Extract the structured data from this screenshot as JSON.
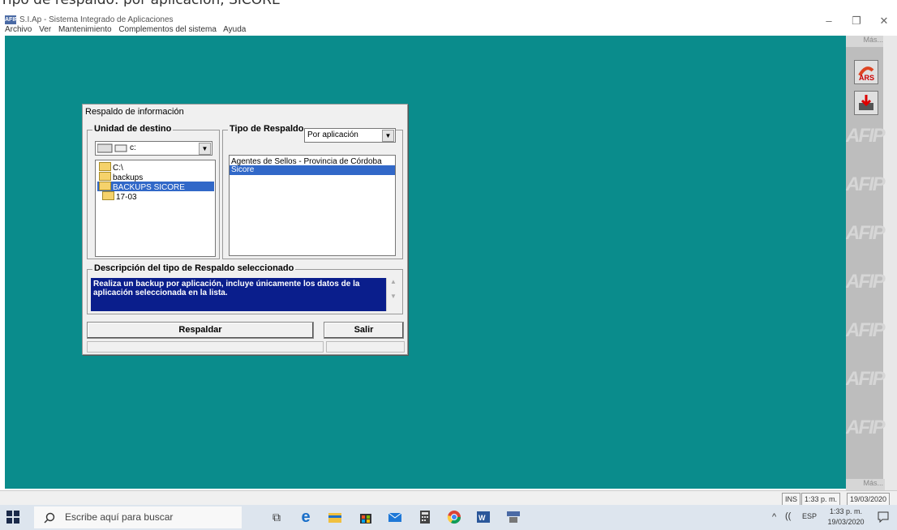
{
  "caption_crop": "Tipo de respaldo: por aplicación, SICORE",
  "window": {
    "title": "S.I.Ap - Sistema Integrado de Aplicaciones",
    "icon_text": "AFIP",
    "menu": [
      "Archivo",
      "Ver",
      "Mantenimiento",
      "Complementos del sistema",
      "Ayuda"
    ]
  },
  "right_panel": {
    "more_label_top": "Más...",
    "more_label_bottom": "Más...",
    "buttons": [
      {
        "icon": "ars-icon",
        "label": "ARS"
      },
      {
        "icon": "download-icon"
      }
    ],
    "watermark_text": "AFIP"
  },
  "dialog": {
    "title": "Respaldo de información",
    "destination": {
      "group_label": "Unidad de destino",
      "drive_value": "c:",
      "tree": [
        {
          "label": "C:\\",
          "selected": false,
          "indent": 0
        },
        {
          "label": "backups",
          "selected": false,
          "indent": 0
        },
        {
          "label": "BACKUPS SICORE",
          "selected": true,
          "indent": 0
        },
        {
          "label": "17-03",
          "selected": false,
          "indent": 1
        }
      ]
    },
    "backup_type": {
      "group_label": "Tipo de Respaldo",
      "select_value": "Por aplicación",
      "items": [
        {
          "label": "Agentes de Sellos - Provincia de Córdoba",
          "selected": false
        },
        {
          "label": "Sicore",
          "selected": true
        }
      ]
    },
    "description": {
      "group_label": "Descripción del tipo de Respaldo seleccionado",
      "text": "Realiza un backup por aplicación, incluye únicamente los datos de la aplicación seleccionada en la lista."
    },
    "buttons": {
      "backup": "Respaldar",
      "exit": "Salir"
    }
  },
  "status_bar": {
    "mode": "INS",
    "time": "1:33 p. m.",
    "date": "19/03/2020"
  },
  "taskbar": {
    "search_placeholder": "Escribe aquí para buscar",
    "apps": [
      "task-view-icon",
      "edge-icon",
      "file-explorer-icon",
      "store-icon",
      "mail-icon",
      "calculator-icon",
      "chrome-icon",
      "word-icon",
      "afip-app-icon"
    ],
    "tray": {
      "language": "ESP",
      "time": "1:33 p. m.",
      "date": "19/03/2020"
    }
  }
}
